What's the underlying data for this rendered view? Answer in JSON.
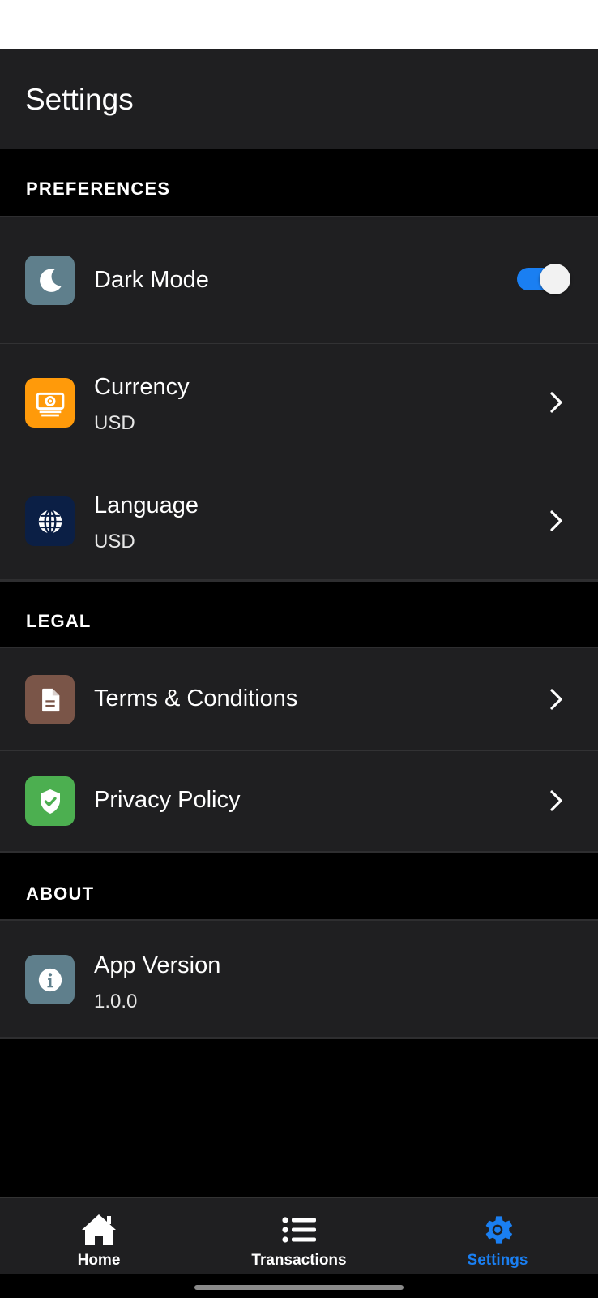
{
  "header": {
    "title": "Settings"
  },
  "sections": {
    "preferences": "PREFERENCES",
    "legal": "LEGAL",
    "about": "ABOUT"
  },
  "preferences": {
    "dark_mode": {
      "label": "Dark Mode",
      "icon": "moon-icon",
      "icon_bg": "#5f7f8c",
      "enabled": true
    },
    "currency": {
      "label": "Currency",
      "value": "USD",
      "icon": "money-icon",
      "icon_bg": "#ff9a0a"
    },
    "language": {
      "label": "Language",
      "value": "USD",
      "icon": "globe-icon",
      "icon_bg": "#0b1f45"
    }
  },
  "legal": {
    "terms": {
      "label": "Terms & Conditions",
      "icon": "document-icon",
      "icon_bg": "#7a5548"
    },
    "privacy": {
      "label": "Privacy Policy",
      "icon": "shield-check-icon",
      "icon_bg": "#4caf50"
    }
  },
  "about": {
    "version": {
      "label": "App Version",
      "value": "1.0.0",
      "icon": "info-icon",
      "icon_bg": "#5f7f8c"
    }
  },
  "tabbar": {
    "home": {
      "label": "Home",
      "icon": "home-icon"
    },
    "transactions": {
      "label": "Transactions",
      "icon": "list-icon"
    },
    "settings": {
      "label": "Settings",
      "icon": "gear-icon",
      "active": true
    }
  },
  "colors": {
    "accent": "#1a7ff2",
    "surface": "#1f1f21",
    "background": "#000000"
  }
}
